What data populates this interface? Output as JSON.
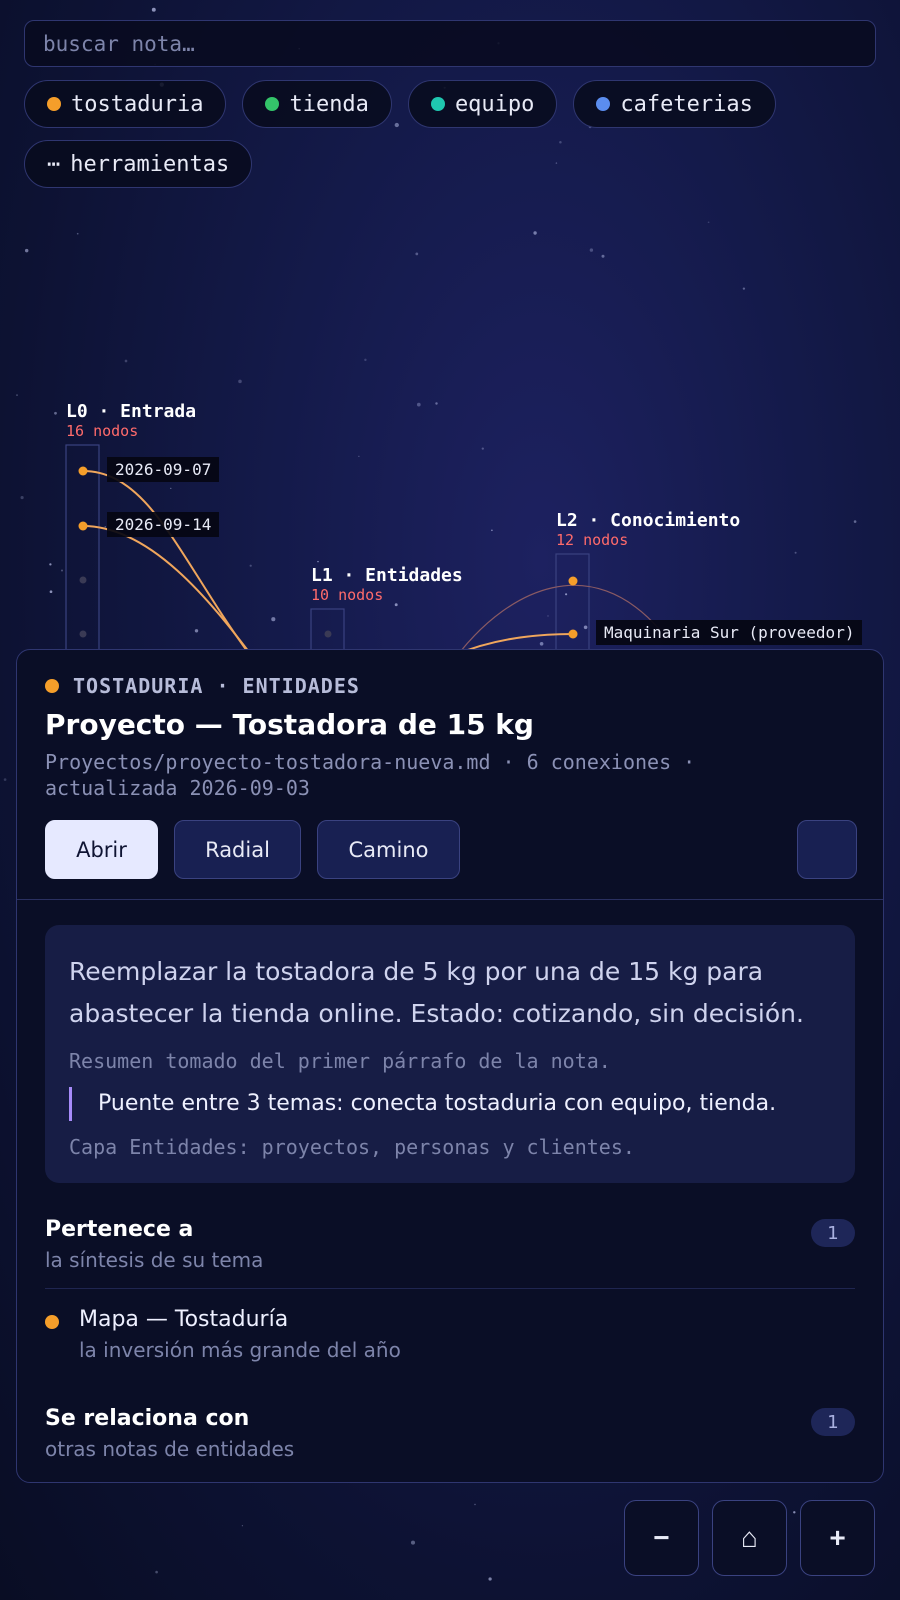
{
  "search": {
    "placeholder": "buscar nota…"
  },
  "chips": [
    {
      "label": "tostaduria",
      "color": "#f59e2a"
    },
    {
      "label": "tienda",
      "color": "#34c46a"
    },
    {
      "label": "equipo",
      "color": "#1fc7b0"
    },
    {
      "label": "cafeterias",
      "color": "#5b8def"
    }
  ],
  "tools_chip": {
    "icon": "ellipsis-icon",
    "glyph": "⋯",
    "label": "herramientas"
  },
  "layers": [
    {
      "title": "L0 · Entrada",
      "count": "16 nodos"
    },
    {
      "title": "L1 · Entidades",
      "count": "10 nodos"
    },
    {
      "title": "L2 · Conocimiento",
      "count": "12 nodos"
    }
  ],
  "node_labels": [
    "2026-09-07",
    "2026-09-14",
    "Maquinaria Sur (proveedor)"
  ],
  "panel": {
    "kicker": "TOSTADURIA · ENTIDADES",
    "kicker_color": "#f59e2a",
    "title": "Proyecto — Tostadora de 15 kg",
    "meta": "Proyectos/proyecto-tostadora-nueva.md · 6 conexiones · actualizada 2026-09-03",
    "actions": {
      "open": "Abrir",
      "radial": "Radial",
      "path": "Camino"
    },
    "summary": {
      "text": "Reemplazar la tostadora de 5 kg por una de 15 kg para abastecer la tienda online. Estado: cotizando, sin decisión.",
      "note": "Resumen tomado del primer párrafo de la nota.",
      "bridge": "Puente entre 3 temas: conecta tostaduria con equipo, tienda.",
      "layer_note": "Capa Entidades: proyectos, personas y clientes."
    },
    "belongs": {
      "title": "Pertenece a",
      "subtitle": "la síntesis de su tema",
      "count": "1",
      "items": [
        {
          "title": "Mapa — Tostaduría",
          "subtitle": "la inversión más grande del año",
          "color": "#f59e2a"
        }
      ]
    },
    "related": {
      "title": "Se relaciona con",
      "subtitle": "otras notas de entidades",
      "count": "1"
    }
  },
  "zoom": {
    "out": "−",
    "home": "⌂",
    "in": "+"
  }
}
